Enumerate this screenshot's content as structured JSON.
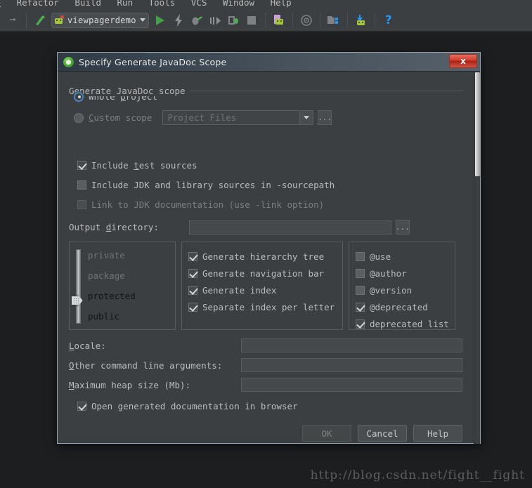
{
  "ide": {
    "menubar": {
      "items": [
        "ze",
        "Refactor",
        "Build",
        "Run",
        "Tools",
        "VCS",
        "Window",
        "Help"
      ]
    },
    "toolbar": {
      "run_config": "viewpagerdemo",
      "icons": [
        "arrow-right-icon",
        "hammer-icon",
        "run-icon",
        "apply-changes-icon",
        "debug-icon",
        "step-icon",
        "attach-debugger-icon",
        "stop-icon",
        "avd-manager-icon",
        "sdk-manager-icon",
        "project-structure-icon",
        "sync-gradle-icon",
        "help-icon"
      ]
    }
  },
  "dialog": {
    "title": "Specify Generate JavaDoc Scope",
    "close_label": "x",
    "scope_group": {
      "legend": "Generate JavaDoc scope",
      "whole_project": {
        "label": "Whole project",
        "mnemonic": "p",
        "selected": true
      },
      "custom_scope": {
        "label": "Custom scope",
        "mnemonic": "C",
        "selected": false
      },
      "scope_combo_value": "Project Files",
      "browse_label": "..."
    },
    "options": [
      {
        "label": "Include test sources",
        "checked": true,
        "disabled": false
      },
      {
        "label": "Include JDK and library sources in -sourcepath",
        "checked": false,
        "disabled": false
      },
      {
        "label": "Link to JDK documentation (use -link option)",
        "checked": false,
        "disabled": true
      }
    ],
    "output_directory": {
      "label": "Output directory:",
      "value": "",
      "browse_label": "..."
    },
    "visibility_slider": {
      "levels": [
        "private",
        "package",
        "protected",
        "public"
      ],
      "selected": "protected"
    },
    "generate_options": [
      {
        "label": "Generate hierarchy tree",
        "checked": true
      },
      {
        "label": "Generate navigation bar",
        "checked": true
      },
      {
        "label": "Generate index",
        "checked": true
      },
      {
        "label": "Separate index per letter",
        "checked": true
      }
    ],
    "tag_options": [
      {
        "label": "@use",
        "checked": false
      },
      {
        "label": "@author",
        "checked": false
      },
      {
        "label": "@version",
        "checked": false
      },
      {
        "label": "@deprecated",
        "checked": true
      },
      {
        "label": "deprecated list",
        "checked": true
      }
    ],
    "fields": [
      {
        "label": "Locale:",
        "value": ""
      },
      {
        "label": "Other command line arguments:",
        "value": ""
      },
      {
        "label": "Maximum heap size (Mb):",
        "value": ""
      }
    ],
    "open_in_browser": {
      "label": "Open generated documentation in browser",
      "checked": true
    },
    "buttons": [
      {
        "label": "OK",
        "disabled": true
      },
      {
        "label": "Cancel",
        "disabled": false
      },
      {
        "label": "Help",
        "disabled": false
      }
    ]
  },
  "watermark": "http://blog.csdn.net/fight__fight",
  "colors": {
    "panel_bg": "#3c3f41",
    "desktop_bg": "#1d1e20",
    "accent_blue": "#4e7fad",
    "run_green": "#43a047",
    "close_red": "#cf3a29"
  }
}
